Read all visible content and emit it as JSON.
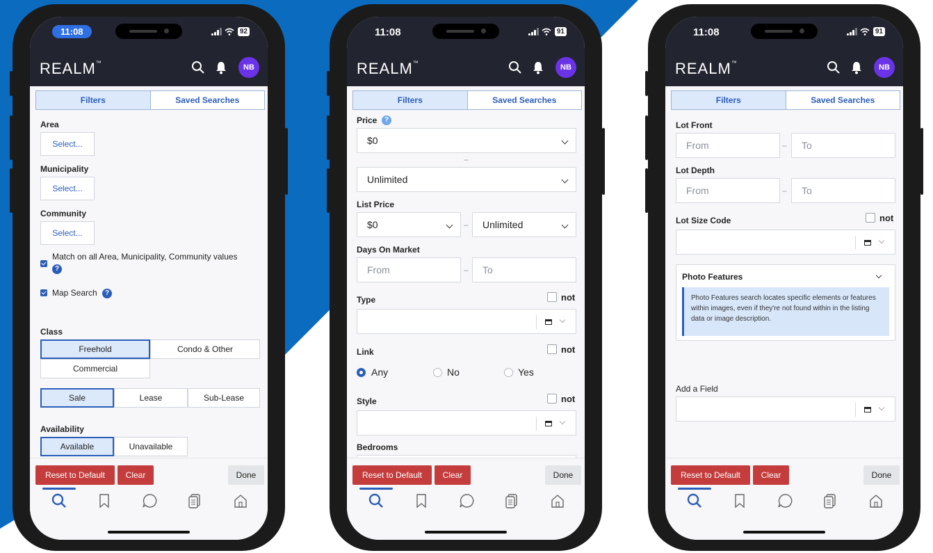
{
  "colors": {
    "accent": "#2b5db8",
    "brand_blue": "#0b6bbf",
    "danger": "#c43c3c",
    "navbar": "#222430",
    "avatar": "#6b33e8"
  },
  "status": {
    "time": "11:08",
    "battery_1": "92",
    "battery_2": "91",
    "battery_3": "91"
  },
  "app": {
    "logo": "REALM",
    "avatar_initials": "NB"
  },
  "tabs": {
    "filters": "Filters",
    "saved": "Saved Searches"
  },
  "screen1": {
    "area_label": "Area",
    "municipality_label": "Municipality",
    "community_label": "Community",
    "select_placeholder": "Select...",
    "match_all_label": "Match on all Area, Municipality, Community values",
    "map_search_label": "Map Search",
    "class_label": "Class",
    "class_options": [
      "Freehold",
      "Condo & Other",
      "Commercial"
    ],
    "selected_class": "Freehold",
    "tx_options": [
      "Sale",
      "Lease",
      "Sub-Lease"
    ],
    "selected_tx": "Sale",
    "availability_label": "Availability",
    "availability_options": [
      "Available",
      "Unavailable"
    ],
    "selected_availability": "Available"
  },
  "screen2": {
    "price_label": "Price",
    "price_min": "$0",
    "price_max": "Unlimited",
    "list_price_label": "List Price",
    "list_price_min": "$0",
    "list_price_max": "Unlimited",
    "dom_label": "Days On Market",
    "from_placeholder": "From",
    "to_placeholder": "To",
    "type_label": "Type",
    "not_label": "not",
    "link_label": "Link",
    "link_options": [
      "Any",
      "No",
      "Yes"
    ],
    "selected_link": "Any",
    "style_label": "Style",
    "bedrooms_label": "Bedrooms"
  },
  "screen3": {
    "lot_front_label": "Lot Front",
    "lot_depth_label": "Lot Depth",
    "from_placeholder": "From",
    "to_placeholder": "To",
    "lot_size_code_label": "Lot Size Code",
    "not_label": "not",
    "photo_features_label": "Photo Features",
    "photo_features_info": "Photo Features search locates specific elements or features within images, even if they're not found within in the listing data or image description.",
    "add_field_label": "Add a Field"
  },
  "actions": {
    "reset": "Reset to Default",
    "clear": "Clear",
    "done": "Done"
  },
  "bottom_nav": [
    "search-icon",
    "bookmark-icon",
    "chat-icon",
    "documents-icon",
    "home-icon"
  ],
  "active_bottom_nav": "search-icon"
}
